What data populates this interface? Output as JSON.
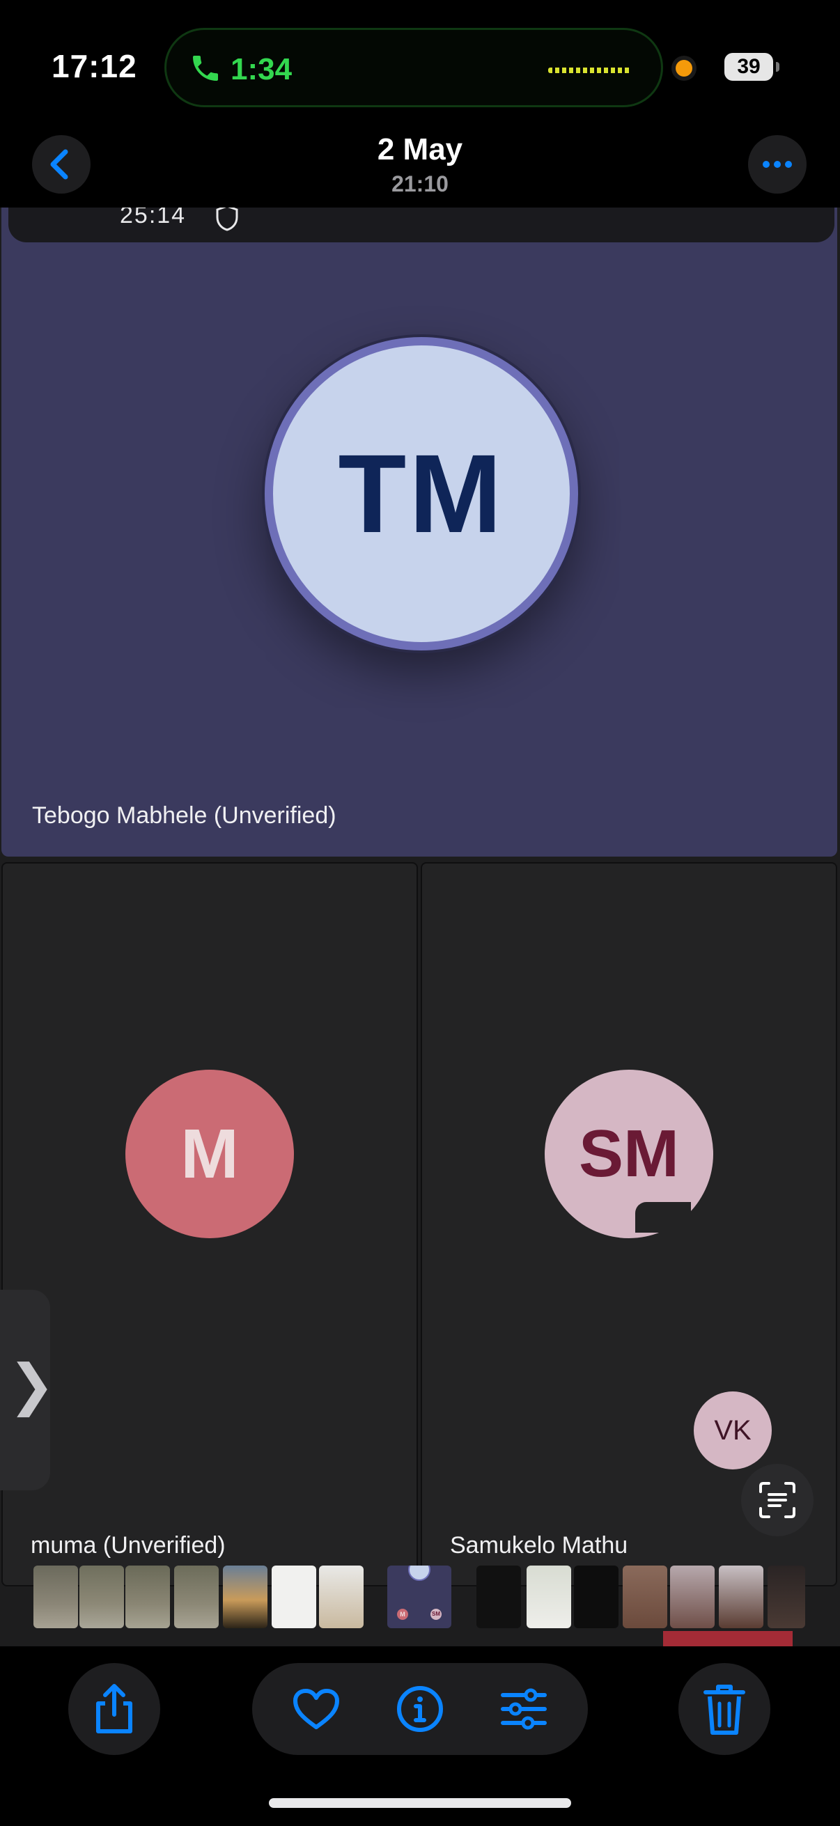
{
  "status_bar": {
    "time": "17:12",
    "call_timer": "1:34",
    "battery": "39"
  },
  "header": {
    "title": "2 May",
    "subtitle": "21:10",
    "back_icon": "chevron-left-icon",
    "more_icon": "ellipsis-icon"
  },
  "photo": {
    "meeting_strip": {
      "time": "25:14",
      "icon": "shield-icon"
    },
    "participants": [
      {
        "initials": "TM",
        "name": "Tebogo Mabhele (Unverified)"
      },
      {
        "initials": "M",
        "name": "muma (Unverified)"
      },
      {
        "initials": "SM",
        "name": "Samukelo Mathu"
      }
    ],
    "floating_avatar": {
      "initials": "VK"
    },
    "current_thumb_avatars": [
      "M",
      "SM"
    ]
  },
  "toolbar": {
    "share_icon": "share-icon",
    "favorite_icon": "heart-icon",
    "info_icon": "info-icon",
    "edit_icon": "adjust-sliders-icon",
    "delete_icon": "trash-icon"
  },
  "colors": {
    "accent": "#0a84ff",
    "call_green": "#33d74f",
    "tile_purple": "#3b3a5e",
    "tile_dark": "#232324",
    "tm_avatar": "#c7d3ec",
    "m_avatar": "#cb6b74",
    "sm_avatar": "#d5b7c4"
  }
}
